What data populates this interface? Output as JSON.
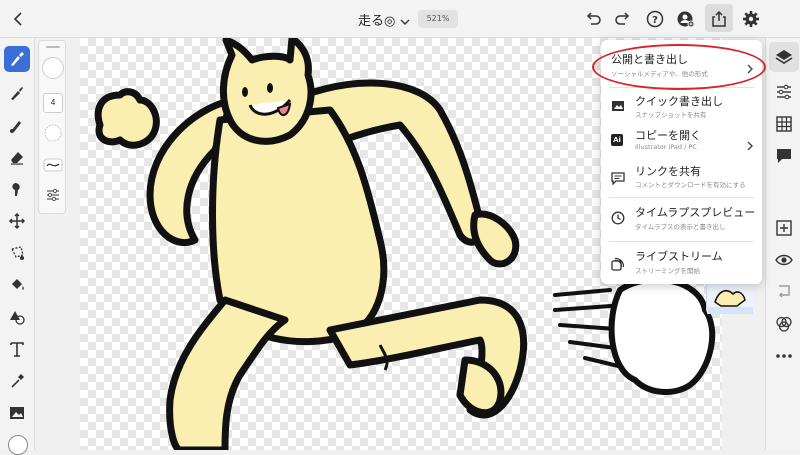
{
  "document": {
    "title": "走る◎",
    "zoom": "521%"
  },
  "brush_panel": {
    "size_value": "4"
  },
  "share_menu": {
    "items": [
      {
        "title": "公開と書き出し",
        "subtitle": "ソーシャルメディアや、他の形式",
        "icon": "none",
        "has_submenu": true
      },
      {
        "title": "クイック書き出し",
        "subtitle": "スナップショットを共有",
        "icon": "image-icon",
        "has_submenu": false
      },
      {
        "title": "コピーを開く",
        "subtitle": "Illustrator iPad / PC",
        "icon": "illustrator-icon",
        "icon_text": "Ai",
        "has_submenu": true
      },
      {
        "title": "リンクを共有",
        "subtitle": "コメントとダウンロードを有効にする",
        "icon": "comment-icon",
        "has_submenu": false
      },
      {
        "title": "タイムラプスプレビュー",
        "subtitle": "タイムラプスの表示と書き出し",
        "icon": "clock-icon",
        "has_submenu": false
      },
      {
        "title": "ライブストリーム",
        "subtitle": "ストリーミングを開始",
        "icon": "livestream-icon",
        "has_submenu": false
      }
    ]
  },
  "colors": {
    "accent": "#3a6fd8",
    "highlight_ring": "#d7262b",
    "character_fill": "#fbeeb1",
    "outline": "#111111"
  }
}
